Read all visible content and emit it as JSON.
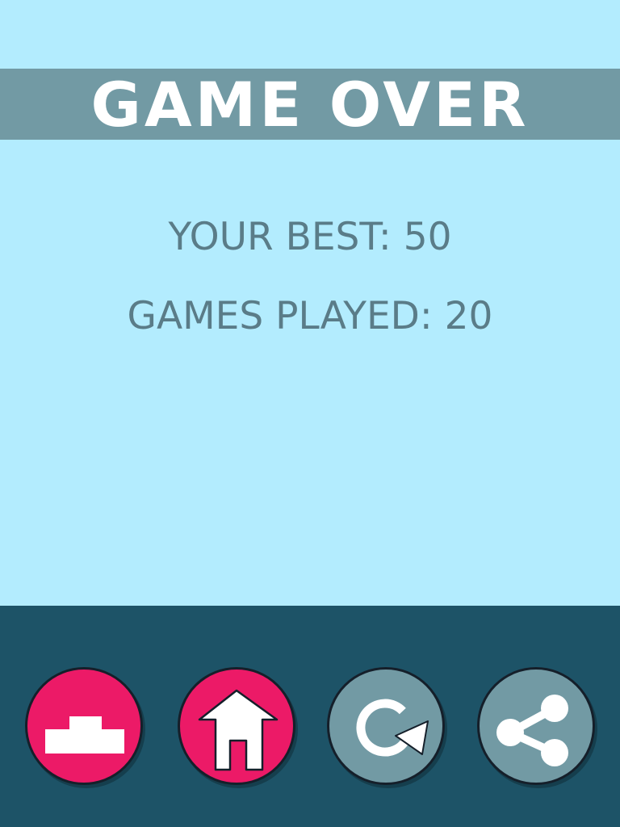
{
  "header": {
    "title": "GAME OVER"
  },
  "stats": {
    "best": "YOUR BEST: 50",
    "games_played": "GAMES PLAYED: 20"
  },
  "buttons": [
    {
      "name": "leaderboard",
      "icon": "podium-icon",
      "color": "#ec1a67"
    },
    {
      "name": "home",
      "icon": "home-icon",
      "color": "#ec1a67"
    },
    {
      "name": "restart",
      "icon": "restart-icon",
      "color": "#729aa4"
    },
    {
      "name": "share",
      "icon": "share-icon",
      "color": "#729aa4"
    }
  ],
  "colors": {
    "background": "#b3ecfe",
    "banner": "#729aa4",
    "footer": "#1d5367",
    "stat_text": "#5a7c88",
    "accent_pink": "#ec1a67"
  }
}
